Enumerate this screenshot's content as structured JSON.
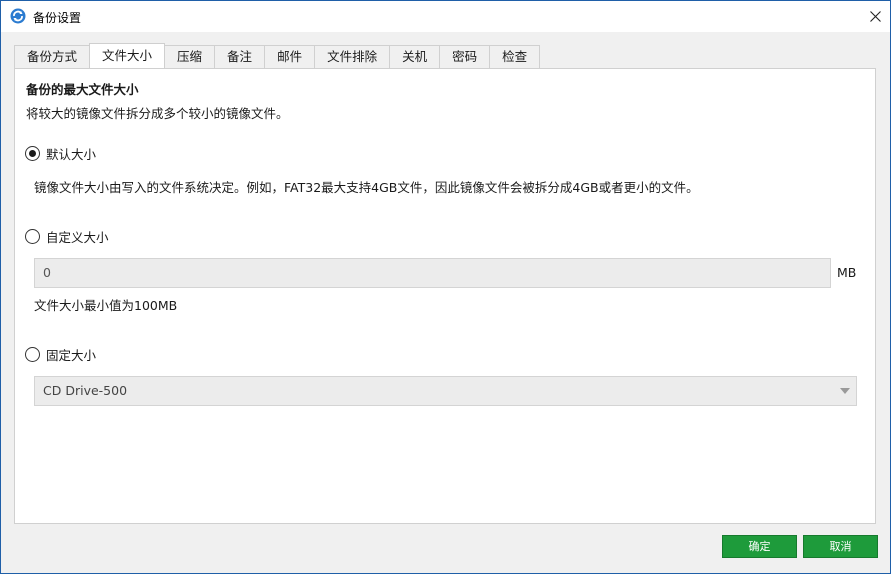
{
  "window": {
    "title": "备份设置"
  },
  "tabs": [
    {
      "label": "备份方式"
    },
    {
      "label": "文件大小"
    },
    {
      "label": "压缩"
    },
    {
      "label": "备注"
    },
    {
      "label": "邮件"
    },
    {
      "label": "文件排除"
    },
    {
      "label": "关机"
    },
    {
      "label": "密码"
    },
    {
      "label": "检查"
    }
  ],
  "active_tab": "文件大小",
  "panel": {
    "title": "备份的最大文件大小",
    "description": "将较大的镜像文件拆分成多个较小的镜像文件。",
    "options": {
      "default": {
        "label": "默认大小",
        "checked": true,
        "info": "镜像文件大小由写入的文件系统决定。例如，FAT32最大支持4GB文件，因此镜像文件会被拆分成4GB或者更小的文件。"
      },
      "custom": {
        "label": "自定义大小",
        "checked": false,
        "value": "0",
        "unit": "MB",
        "hint": "文件大小最小值为100MB"
      },
      "fixed": {
        "label": "固定大小",
        "checked": false,
        "selected": "CD Drive-500"
      }
    }
  },
  "buttons": {
    "ok": "确定",
    "cancel": "取消"
  },
  "colors": {
    "accent": "#1e9b3b",
    "border": "#1f5fa8",
    "icon_blue": "#2b7bd0"
  }
}
